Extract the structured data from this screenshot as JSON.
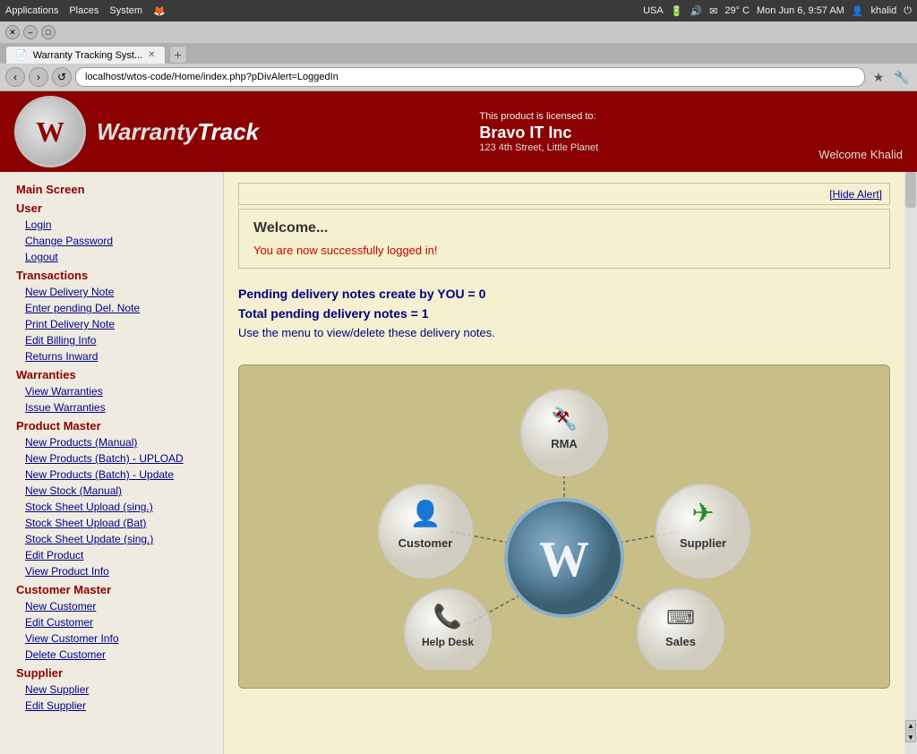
{
  "os": {
    "left_items": [
      "Applications",
      "Places",
      "System"
    ],
    "firefox_label": "Firefox",
    "keyboard_layout": "USA",
    "temperature": "29° C",
    "datetime": "Mon Jun 6, 9:57 AM",
    "username": "khalid"
  },
  "browser": {
    "tab_title": "Warranty Tracking Syst...",
    "url": "localhost/wtos-code/Home/index.php?pDivAlert=LoggedIn",
    "new_tab_symbol": "+",
    "nav": {
      "back": "‹",
      "forward": "›",
      "reload": "↺"
    }
  },
  "header": {
    "licensed_to": "This product is licensed to:",
    "company": "Bravo IT Inc",
    "address": "123 4th Street, Little Planet",
    "welcome": "Welcome Khalid",
    "logo_letter": "W",
    "logo_name": "WarrantyTrack"
  },
  "sidebar": {
    "section_main": "Main Screen",
    "section_user": "User",
    "user_links": [
      {
        "label": "Login",
        "id": "login"
      },
      {
        "label": "Change Password",
        "id": "change-password"
      },
      {
        "label": "Logout",
        "id": "logout"
      }
    ],
    "section_transactions": "Transactions",
    "transaction_links": [
      {
        "label": "New Delivery Note",
        "id": "new-delivery-note"
      },
      {
        "label": "Enter pending Del. Note",
        "id": "enter-pending-del-note"
      },
      {
        "label": "Print Delivery Note",
        "id": "print-delivery-note"
      },
      {
        "label": "Edit Billing Info",
        "id": "edit-billing-info"
      },
      {
        "label": "Returns Inward",
        "id": "returns-inward"
      }
    ],
    "section_warranties": "Warranties",
    "warranty_links": [
      {
        "label": "View Warranties",
        "id": "view-warranties"
      },
      {
        "label": "Issue Warranties",
        "id": "issue-warranties"
      }
    ],
    "section_product": "Product Master",
    "product_links": [
      {
        "label": "New Products (Manual)",
        "id": "new-products-manual"
      },
      {
        "label": "New Products (Batch) - UPLOAD",
        "id": "new-products-batch-upload"
      },
      {
        "label": "New Products (Batch) - Update",
        "id": "new-products-batch-update"
      },
      {
        "label": "New Stock (Manual)",
        "id": "new-stock-manual"
      },
      {
        "label": "Stock Sheet Upload (sing.)",
        "id": "stock-sheet-upload-sing"
      },
      {
        "label": "Stock Sheet Upload (Bat)",
        "id": "stock-sheet-upload-bat"
      },
      {
        "label": "Stock Sheet Update (sing.)",
        "id": "stock-sheet-update-sing"
      },
      {
        "label": "Edit Product",
        "id": "edit-product"
      },
      {
        "label": "View Product Info",
        "id": "view-product-info"
      }
    ],
    "section_customer": "Customer Master",
    "customer_links": [
      {
        "label": "New Customer",
        "id": "new-customer"
      },
      {
        "label": "Edit Customer",
        "id": "edit-customer"
      },
      {
        "label": "View Customer Info",
        "id": "view-customer-info"
      },
      {
        "label": "Delete Customer",
        "id": "delete-customer"
      }
    ],
    "section_supplier": "Supplier",
    "supplier_links": [
      {
        "label": "New Supplier",
        "id": "new-supplier"
      },
      {
        "label": "Edit Supplier",
        "id": "edit-supplier"
      }
    ]
  },
  "content": {
    "hide_alert": "[Hide Alert]",
    "welcome_title": "Welcome...",
    "welcome_message": "You are now successfully logged in!",
    "stat1": "Pending delivery notes create by YOU = 0",
    "stat2": "Total pending delivery notes = 1",
    "stat_note": "Use the menu to view/delete these delivery notes.",
    "diagram": {
      "center_letter": "W",
      "nodes": [
        {
          "id": "rma",
          "label": "RMA",
          "icon": "🔧"
        },
        {
          "id": "customer",
          "label": "Customer",
          "icon": "👤"
        },
        {
          "id": "supplier",
          "label": "Supplier",
          "icon": "✈"
        },
        {
          "id": "helpdesk",
          "label": "Help Desk",
          "icon": "📞"
        },
        {
          "id": "sales",
          "label": "Sales",
          "icon": "⌨"
        }
      ]
    }
  }
}
